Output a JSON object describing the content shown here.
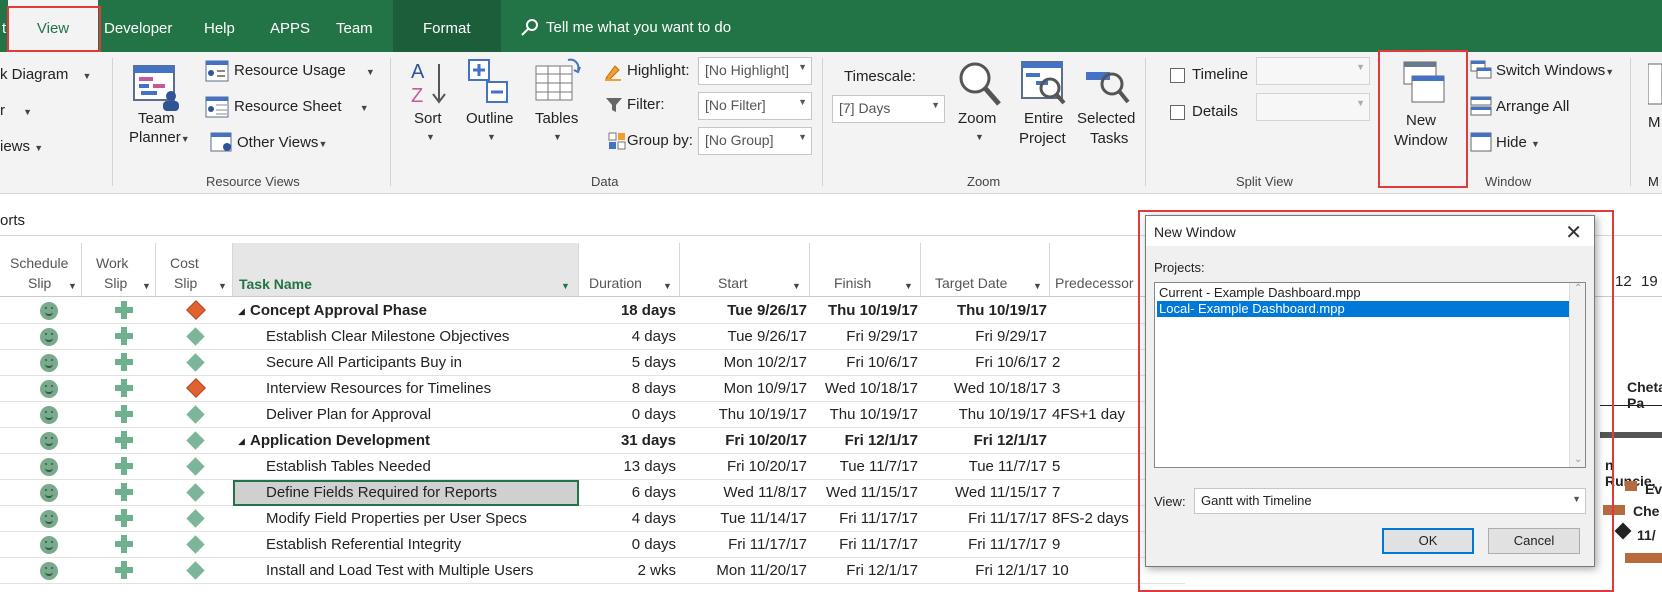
{
  "tabs": {
    "partial": "t",
    "view": "View",
    "developer": "Developer",
    "help": "Help",
    "apps": "APPS",
    "team": "Team",
    "format": "Format",
    "tellme": "Tell me what you want to do"
  },
  "ribbon": {
    "task_views": {
      "diagram": "k Diagram",
      "r": "r",
      "views": "iews"
    },
    "resource_views": {
      "team_planner_1": "Team",
      "team_planner_2": "Planner",
      "resource_usage": "Resource Usage",
      "resource_sheet": "Resource Sheet",
      "other_views": "Other Views",
      "label": "Resource Views"
    },
    "data": {
      "sort": "Sort",
      "outline": "Outline",
      "tables": "Tables",
      "highlight_label": "Highlight:",
      "highlight_value": "[No Highlight]",
      "filter_label": "Filter:",
      "filter_value": "[No Filter]",
      "group_label": "Group by:",
      "group_value": "[No Group]",
      "label": "Data"
    },
    "zoom": {
      "timescale_label": "Timescale:",
      "timescale_value": "[7] Days",
      "zoom": "Zoom",
      "entire_1": "Entire",
      "entire_2": "Project",
      "selected_1": "Selected",
      "selected_2": "Tasks",
      "label": "Zoom"
    },
    "split_view": {
      "timeline": "Timeline",
      "details": "Details",
      "label": "Split View"
    },
    "window": {
      "new_1": "New",
      "new_2": "Window",
      "switch": "Switch Windows",
      "arrange": "Arrange All",
      "hide": "Hide",
      "label": "Window",
      "partial": "M"
    }
  },
  "formula_bar": "orts",
  "columns": {
    "schedule_1": "Schedule",
    "schedule_2": "Slip",
    "work_1": "Work",
    "work_2": "Slip",
    "cost_1": "Cost",
    "cost_2": "Slip",
    "task_name": "Task Name",
    "duration": "Duration",
    "start": "Start",
    "finish": "Finish",
    "target_date": "Target Date",
    "predecessors": "Predecessor"
  },
  "rows": [
    {
      "name": "Concept Approval Phase",
      "duration": "18 days",
      "start": "Tue 9/26/17",
      "finish": "Thu 10/19/17",
      "target": "Thu 10/19/17",
      "pred": "",
      "summary": true,
      "cost": "red"
    },
    {
      "name": "Establish Clear Milestone Objectives",
      "duration": "4 days",
      "start": "Tue 9/26/17",
      "finish": "Fri 9/29/17",
      "target": "Fri 9/29/17",
      "pred": "",
      "summary": false,
      "cost": "green"
    },
    {
      "name": "Secure All Participants Buy in",
      "duration": "5 days",
      "start": "Mon 10/2/17",
      "finish": "Fri 10/6/17",
      "target": "Fri 10/6/17",
      "pred": "2",
      "summary": false,
      "cost": "green"
    },
    {
      "name": "Interview Resources for Timelines",
      "duration": "8 days",
      "start": "Mon 10/9/17",
      "finish": "Wed 10/18/17",
      "target": "Wed 10/18/17",
      "pred": "3",
      "summary": false,
      "cost": "red"
    },
    {
      "name": "Deliver Plan for Approval",
      "duration": "0 days",
      "start": "Thu 10/19/17",
      "finish": "Thu 10/19/17",
      "target": "Thu 10/19/17",
      "pred": "4FS+1 day",
      "summary": false,
      "cost": "green"
    },
    {
      "name": "Application Development",
      "duration": "31 days",
      "start": "Fri 10/20/17",
      "finish": "Fri 12/1/17",
      "target": "Fri 12/1/17",
      "pred": "",
      "summary": true,
      "cost": "green"
    },
    {
      "name": "Establish Tables Needed",
      "duration": "13 days",
      "start": "Fri 10/20/17",
      "finish": "Tue 11/7/17",
      "target": "Tue 11/7/17",
      "pred": "5",
      "summary": false,
      "cost": "green"
    },
    {
      "name": "Define Fields Required for Reports",
      "duration": "6 days",
      "start": "Wed 11/8/17",
      "finish": "Wed 11/15/17",
      "target": "Wed 11/15/17",
      "pred": "7",
      "summary": false,
      "cost": "green"
    },
    {
      "name": "Modify Field Properties per User Specs",
      "duration": "4 days",
      "start": "Tue 11/14/17",
      "finish": "Fri 11/17/17",
      "target": "Fri 11/17/17",
      "pred": "8FS-2 days",
      "summary": false,
      "cost": "green"
    },
    {
      "name": "Establish Referential Integrity",
      "duration": "0 days",
      "start": "Fri 11/17/17",
      "finish": "Fri 11/17/17",
      "target": "Fri 11/17/17",
      "pred": "9",
      "summary": false,
      "cost": "green"
    },
    {
      "name": "Install and Load Test with Multiple Users",
      "duration": "2 wks",
      "start": "Mon 11/20/17",
      "finish": "Fri 12/1/17",
      "target": "Fri 12/1/17",
      "pred": "10",
      "summary": false,
      "cost": "green"
    }
  ],
  "gantt": {
    "tick_12": "12",
    "tick_19": "19",
    "label_1": "Chetan Pa",
    "label_2": "n Runcie,",
    "label_3": "Evere",
    "label_4": "Che",
    "label_5": "11/"
  },
  "dialog": {
    "title": "New Window",
    "projects_label": "Projects:",
    "projects": [
      "Current - Example Dashboard.mpp",
      "Local- Example Dashboard.mpp"
    ],
    "view_label": "View:",
    "view_value": "Gantt with Timeline",
    "ok": "OK",
    "cancel": "Cancel"
  },
  "colors": {
    "ribbon_green": "#227447",
    "highlight_red": "#e2393b",
    "selection_blue": "#0078d7"
  }
}
